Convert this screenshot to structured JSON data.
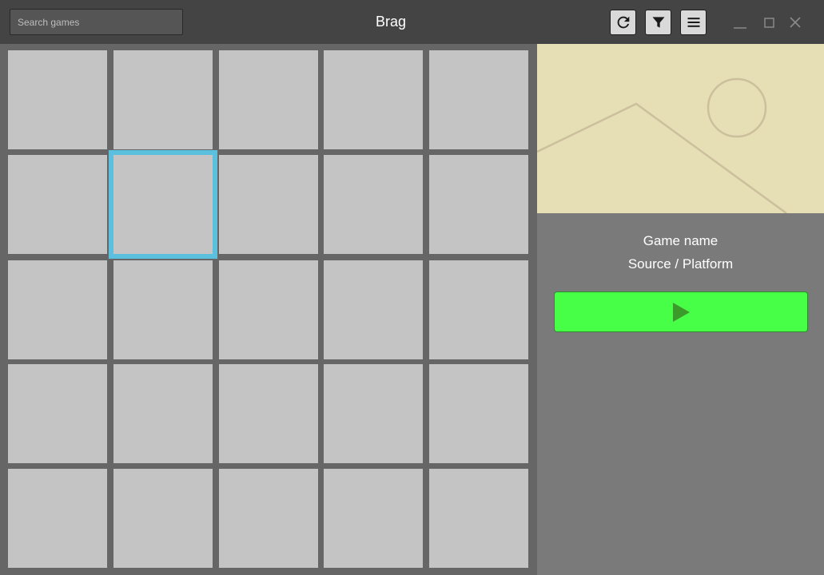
{
  "window": {
    "title": "Brag",
    "controls": [
      "minimize-icon",
      "maximize-icon",
      "close-icon"
    ]
  },
  "toolbar": {
    "search": {
      "placeholder": "Search games",
      "value": ""
    },
    "buttons": [
      {
        "name": "refresh-button",
        "icon": "refresh-icon"
      },
      {
        "name": "filter-button",
        "icon": "filter-icon"
      },
      {
        "name": "menu-button",
        "icon": "hamburger-menu-icon"
      }
    ]
  },
  "grid": {
    "rows": 5,
    "columns": 5,
    "selected_index": 6
  },
  "detail": {
    "cover_icon": "image-placeholder-icon",
    "game_name": "Game name",
    "source_platform": "Source / Platform",
    "play_icon": "play-icon"
  },
  "colors": {
    "titlebar": "#444444",
    "background": "#666666",
    "tile": "#c4c4c4",
    "selection": "#5bc0de",
    "panel": "#7a7a7a",
    "cover": "#e6deb5",
    "cover_lines": "#cbbf9c",
    "play_button": "#47ff47",
    "play_icon": "#3a9a2a"
  }
}
